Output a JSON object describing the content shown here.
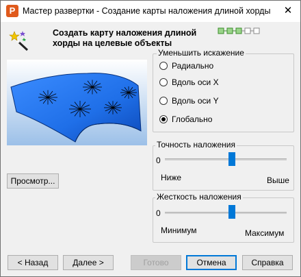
{
  "window": {
    "title": "Мастер развертки - Создание карты наложения длиной хорды",
    "close_glyph": "✕"
  },
  "header": {
    "heading": "Создать карту наложения длиной хорды на целевые объекты",
    "step_count": 5,
    "current_step": 3
  },
  "preview": {
    "button_label": "Просмотр..."
  },
  "distortion": {
    "legend": "Уменьшить искажение",
    "options": [
      "Радиально",
      "Вдоль оси X",
      "Вдоль оси Y",
      "Глобально"
    ],
    "selected": "Глобально"
  },
  "accuracy": {
    "legend": "Точность наложения",
    "value_label": "0",
    "min_label": "Ниже",
    "max_label": "Выше",
    "level": 0.55
  },
  "stiffness": {
    "legend": "Жесткость наложения",
    "value_label": "0",
    "min_label": "Минимум",
    "max_label": "Максимум",
    "level": 0.55
  },
  "footer": {
    "back": "< Назад",
    "next": "Далее >",
    "finish": "Готово",
    "cancel": "Отмена",
    "help": "Справка"
  },
  "colors": {
    "accent": "#0078d7",
    "surface": "#1f6fe8"
  }
}
